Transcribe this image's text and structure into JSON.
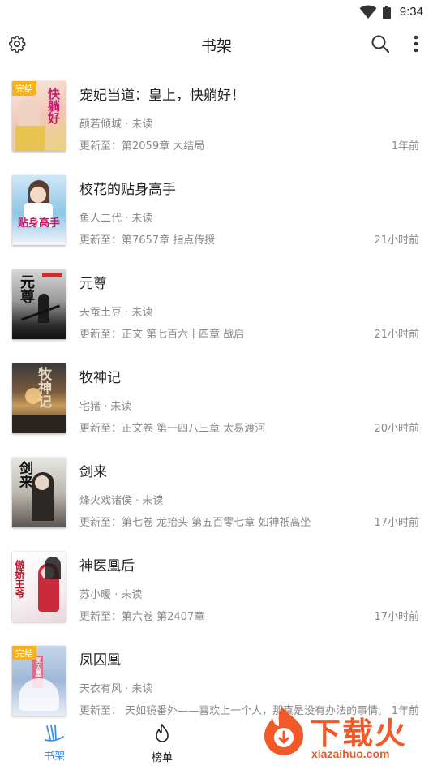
{
  "status": {
    "time": "9:34"
  },
  "header": {
    "title": "书架"
  },
  "books": [
    {
      "title": "宠妃当道：皇上，快躺好！",
      "author": "颜若倾城 · 未读",
      "update": "更新至：第2059章 大结局",
      "time": "1年前",
      "badge": "完结",
      "cover_text": "快躺好"
    },
    {
      "title": "校花的贴身高手",
      "author": "鱼人二代 · 未读",
      "update": "更新至：第7657章 指点传授",
      "time": "21小时前",
      "badge": "",
      "cover_text": "贴身高手"
    },
    {
      "title": "元尊",
      "author": "天蚕土豆 · 未读",
      "update": "更新至：正文 第七百六十四章 战启",
      "time": "21小时前",
      "badge": "",
      "cover_text": "元尊"
    },
    {
      "title": "牧神记",
      "author": "宅猪 · 未读",
      "update": "更新至：正文卷 第一四八三章 太易渡河",
      "time": "20小时前",
      "badge": "",
      "cover_text": "牧神记"
    },
    {
      "title": "剑来",
      "author": "烽火戏诸侯 · 未读",
      "update": "更新至：第七卷 龙抬头 第五百零七章 如神祇高坐",
      "time": "17小时前",
      "badge": "",
      "cover_text": "剑来"
    },
    {
      "title": "神医凰后",
      "author": "苏小暖 · 未读",
      "update": "更新至：第六卷 第2407章",
      "time": "17小时前",
      "badge": "",
      "cover_text": "傲娇王爷"
    },
    {
      "title": "凤囚凰",
      "author": "天衣有风 · 未读",
      "update": "更新至： 天如镜番外——喜欢上一个人，那真是没有办法的事情。",
      "time": "1年前",
      "badge": "完结",
      "cover_text": "凤囚凰"
    }
  ],
  "nav": {
    "bookshelf": "书架",
    "ranking": "榜单"
  },
  "watermark": {
    "brand": "下载火",
    "url": "xiazaihuo.com"
  },
  "colors": {
    "accent": "#3d8ee6",
    "badge": "#f5b21e",
    "watermark": "#f05a28"
  }
}
